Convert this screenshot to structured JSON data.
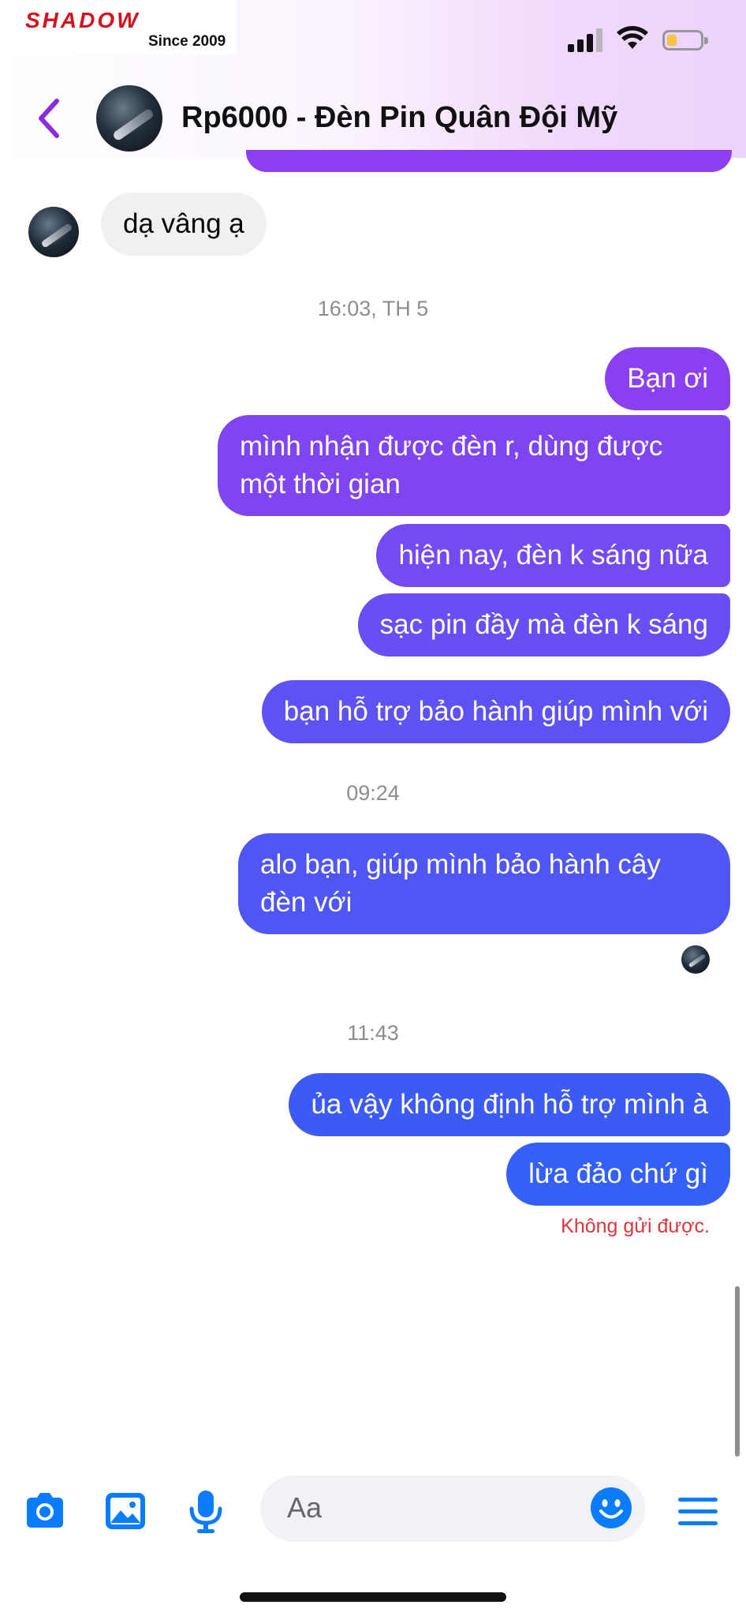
{
  "status_bar": {
    "logo_text": "SHADOW",
    "logo_sub": "Since 2009",
    "signal_icon": "cellular-signal-icon",
    "wifi_icon": "wifi-icon",
    "battery_icon": "battery-low-icon",
    "battery_level": 0.2
  },
  "header": {
    "back_icon": "chevron-left-icon",
    "title": "Rp6000 - Đèn Pin Quân Đội Mỹ",
    "accent_color": "#8a2be2"
  },
  "messages": {
    "incoming_1": "dạ vâng ạ",
    "timestamp_1": "16:03, TH 5",
    "out_1": "Bạn ơi",
    "out_2": "mình nhận được đèn r, dùng được một thời gian",
    "out_3": "hiện nay, đèn k sáng nữa",
    "out_4": "sạc pin đầy mà đèn k sáng",
    "out_5": "bạn hỗ trợ bảo hành giúp mình với",
    "timestamp_2": "09:24",
    "out_6": "alo bạn, giúp mình bảo hành cây đèn với",
    "timestamp_3": "11:43",
    "out_7": "ủa vậy không định hỗ trợ mình à",
    "out_8": "lừa đảo chứ gì",
    "error": "Không gửi được."
  },
  "composer": {
    "placeholder": "Aa",
    "camera_icon": "camera-icon",
    "gallery_icon": "image-icon",
    "mic_icon": "microphone-icon",
    "emoji_icon": "smile-emoji-icon",
    "menu_icon": "menu-icon",
    "accent_color": "#0a7cff"
  }
}
